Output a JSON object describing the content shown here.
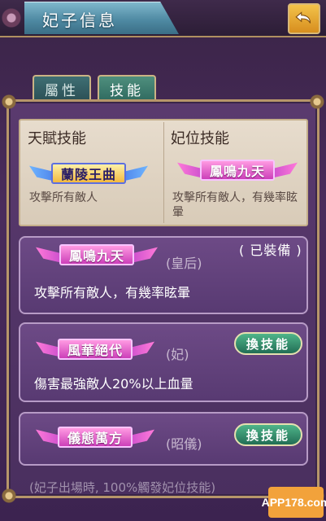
{
  "header": {
    "title": "妃子信息",
    "back_icon": "return-arrow-icon"
  },
  "tabs": [
    {
      "label": "屬性",
      "active": false
    },
    {
      "label": "技能",
      "active": true
    }
  ],
  "innate_skill": {
    "heading": "天賦技能",
    "banner": "蘭陵王曲",
    "description": "攻擊所有敵人"
  },
  "rank_skill": {
    "heading": "妃位技能",
    "banner": "鳳鳴九天",
    "description": "攻擊所有敵人，有幾率眩暈"
  },
  "skills": [
    {
      "banner": "鳳鳴九天",
      "rank": "(皇后)",
      "status": "( 已裝備 )",
      "description": "攻擊所有敵人，有幾率眩暈"
    },
    {
      "banner": "風華絕代",
      "rank": "(妃)",
      "button": "換技能",
      "description": "傷害最強敵人20%以上血量"
    },
    {
      "banner": "儀態萬方",
      "rank": "(昭儀)",
      "button": "換技能"
    }
  ],
  "footer_note": "(妃子出場時, 100%觸發妃位技能)",
  "watermark": "APP178.com",
  "colors": {
    "tab_active": "#2f6a5f",
    "swap_button": "#226e55",
    "back_button": "#f3c34a"
  }
}
